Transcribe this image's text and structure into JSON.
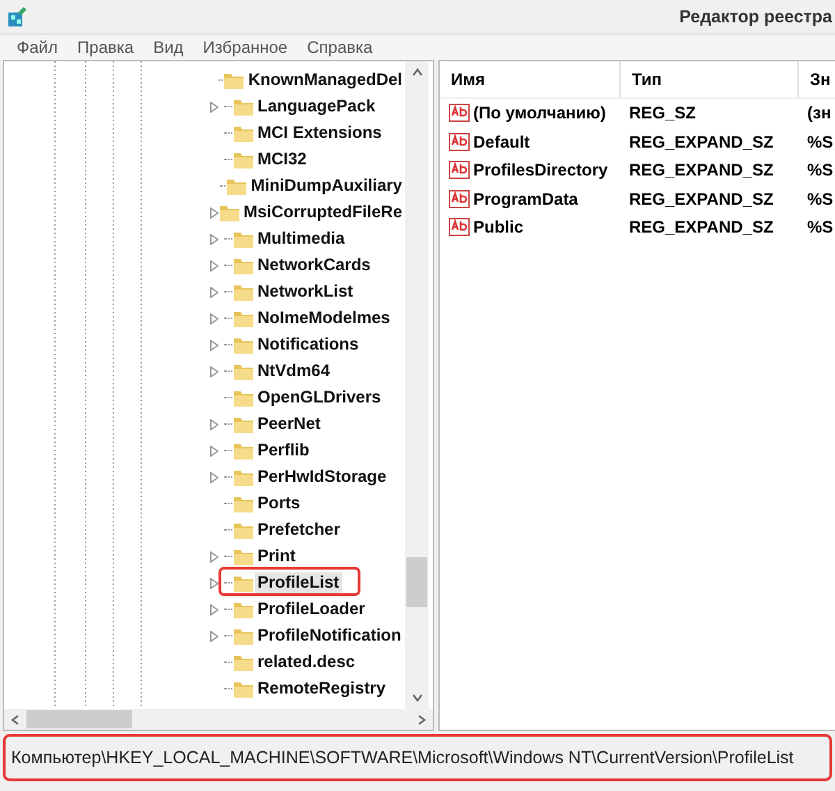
{
  "window": {
    "title": "Редактор реестра"
  },
  "menu": [
    "Файл",
    "Правка",
    "Вид",
    "Избранное",
    "Справка"
  ],
  "tree": {
    "items": [
      {
        "label": "KnownManagedDel",
        "expandable": false,
        "selected": false,
        "annotated": false
      },
      {
        "label": "LanguagePack",
        "expandable": true,
        "selected": false,
        "annotated": false
      },
      {
        "label": "MCI Extensions",
        "expandable": false,
        "selected": false,
        "annotated": false
      },
      {
        "label": "MCI32",
        "expandable": false,
        "selected": false,
        "annotated": false
      },
      {
        "label": "MiniDumpAuxiliary",
        "expandable": false,
        "selected": false,
        "annotated": false
      },
      {
        "label": "MsiCorruptedFileRe",
        "expandable": true,
        "selected": false,
        "annotated": false
      },
      {
        "label": "Multimedia",
        "expandable": true,
        "selected": false,
        "annotated": false
      },
      {
        "label": "NetworkCards",
        "expandable": true,
        "selected": false,
        "annotated": false
      },
      {
        "label": "NetworkList",
        "expandable": true,
        "selected": false,
        "annotated": false
      },
      {
        "label": "NoImeModelmes",
        "expandable": true,
        "selected": false,
        "annotated": false
      },
      {
        "label": "Notifications",
        "expandable": true,
        "selected": false,
        "annotated": false
      },
      {
        "label": "NtVdm64",
        "expandable": true,
        "selected": false,
        "annotated": false
      },
      {
        "label": "OpenGLDrivers",
        "expandable": false,
        "selected": false,
        "annotated": false
      },
      {
        "label": "PeerNet",
        "expandable": true,
        "selected": false,
        "annotated": false
      },
      {
        "label": "Perflib",
        "expandable": true,
        "selected": false,
        "annotated": false
      },
      {
        "label": "PerHwIdStorage",
        "expandable": true,
        "selected": false,
        "annotated": false
      },
      {
        "label": "Ports",
        "expandable": false,
        "selected": false,
        "annotated": false
      },
      {
        "label": "Prefetcher",
        "expandable": false,
        "selected": false,
        "annotated": false
      },
      {
        "label": "Print",
        "expandable": true,
        "selected": false,
        "annotated": false
      },
      {
        "label": "ProfileList",
        "expandable": true,
        "selected": true,
        "annotated": true
      },
      {
        "label": "ProfileLoader",
        "expandable": true,
        "selected": false,
        "annotated": false
      },
      {
        "label": "ProfileNotification",
        "expandable": true,
        "selected": false,
        "annotated": false
      },
      {
        "label": "related.desc",
        "expandable": false,
        "selected": false,
        "annotated": false
      },
      {
        "label": "RemoteRegistry",
        "expandable": false,
        "selected": false,
        "annotated": false
      }
    ]
  },
  "values": {
    "columns": [
      "Имя",
      "Тип",
      "Зн"
    ],
    "rows": [
      {
        "name": "(По умолчанию)",
        "type": "REG_SZ",
        "data": "(зн"
      },
      {
        "name": "Default",
        "type": "REG_EXPAND_SZ",
        "data": "%S"
      },
      {
        "name": "ProfilesDirectory",
        "type": "REG_EXPAND_SZ",
        "data": "%S"
      },
      {
        "name": "ProgramData",
        "type": "REG_EXPAND_SZ",
        "data": "%S"
      },
      {
        "name": "Public",
        "type": "REG_EXPAND_SZ",
        "data": "%S"
      }
    ]
  },
  "status_bar": {
    "text": "Компьютер\\HKEY_LOCAL_MACHINE\\SOFTWARE\\Microsoft\\Windows NT\\CurrentVersion\\ProfileList",
    "annotated": true
  }
}
